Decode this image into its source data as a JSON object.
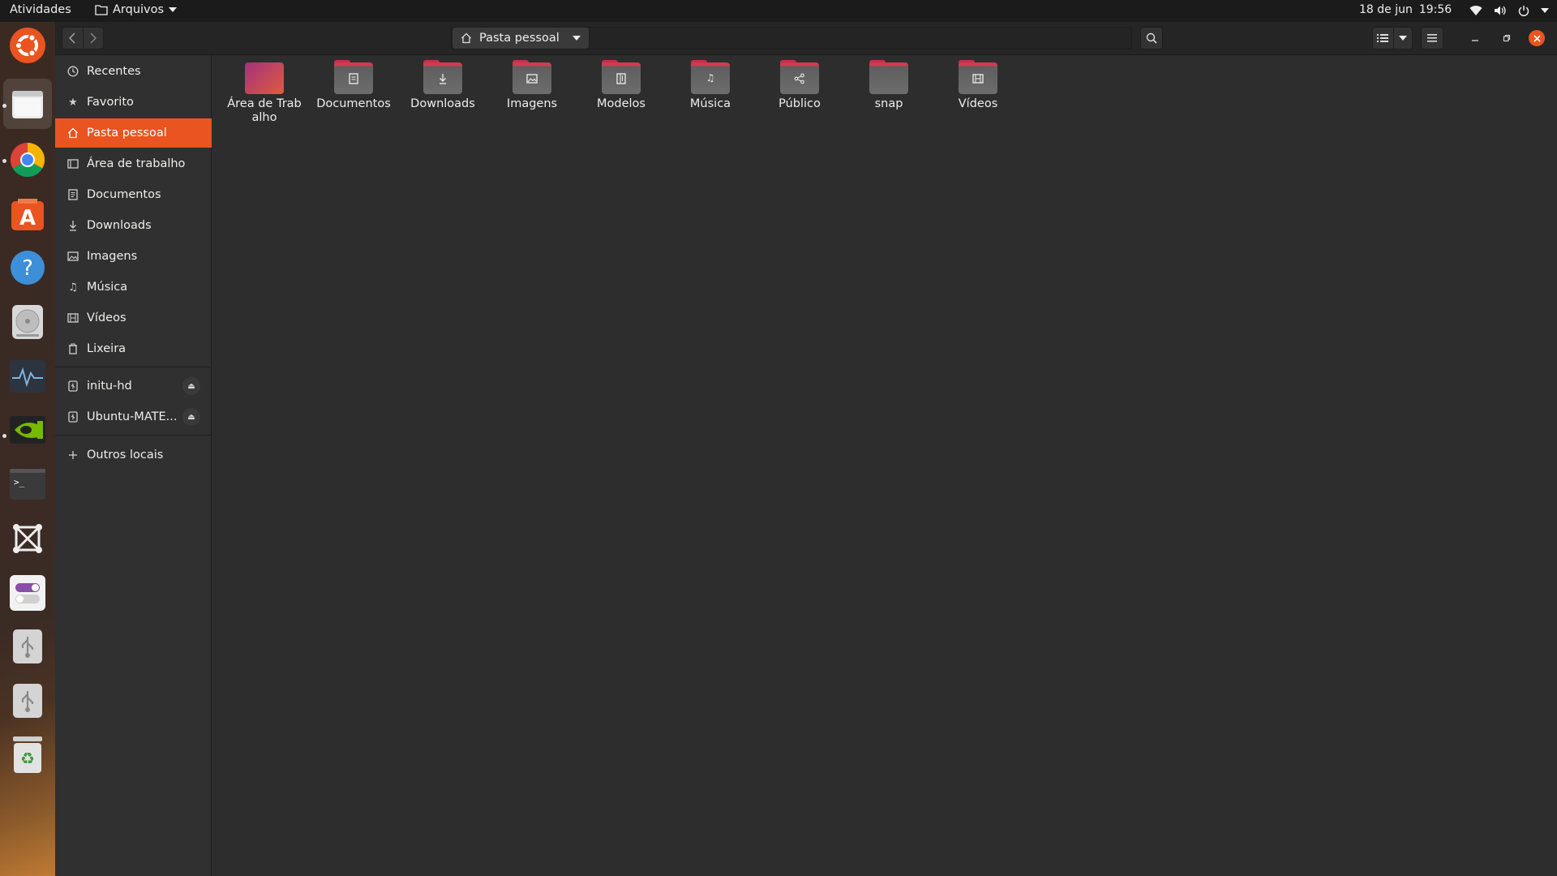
{
  "topbar": {
    "activities": "Atividades",
    "app_name": "Arquivos",
    "date": "18 de jun",
    "time": "19:56"
  },
  "dock": {
    "items": [
      {
        "name": "ubuntu-logo-icon"
      },
      {
        "name": "files-app-icon"
      },
      {
        "name": "chrome-icon"
      },
      {
        "name": "software-center-icon"
      },
      {
        "name": "help-icon"
      },
      {
        "name": "disks-icon"
      },
      {
        "name": "system-monitor-icon"
      },
      {
        "name": "nvidia-icon"
      },
      {
        "name": "terminal-icon"
      },
      {
        "name": "screenshot-tool-icon"
      },
      {
        "name": "settings-toggle-icon"
      },
      {
        "name": "usb-drive-icon"
      },
      {
        "name": "usb-drive-icon"
      },
      {
        "name": "trash-icon"
      }
    ]
  },
  "headerbar": {
    "location": "Pasta pessoal"
  },
  "sidebar": {
    "places": [
      {
        "label": "Recentes",
        "icon": "clock-icon"
      },
      {
        "label": "Favorito",
        "icon": "star-icon"
      },
      {
        "label": "Pasta pessoal",
        "icon": "home-icon",
        "selected": true
      },
      {
        "label": "Área de trabalho",
        "icon": "desktop-icon"
      },
      {
        "label": "Documentos",
        "icon": "document-icon"
      },
      {
        "label": "Downloads",
        "icon": "download-icon"
      },
      {
        "label": "Imagens",
        "icon": "image-icon"
      },
      {
        "label": "Música",
        "icon": "music-icon"
      },
      {
        "label": "Vídeos",
        "icon": "video-icon"
      },
      {
        "label": "Lixeira",
        "icon": "trash-icon"
      }
    ],
    "devices": [
      {
        "label": "initu-hd",
        "icon": "usb-drive-icon"
      },
      {
        "label": "Ubuntu-MATE...",
        "icon": "usb-drive-icon"
      }
    ],
    "other": {
      "label": "Outros locais",
      "icon": "plus-icon"
    }
  },
  "folders": [
    {
      "name": "Área de Trabalho",
      "icon": "desktop-folder-icon"
    },
    {
      "name": "Documentos",
      "icon": "documents-folder-icon"
    },
    {
      "name": "Downloads",
      "icon": "downloads-folder-icon"
    },
    {
      "name": "Imagens",
      "icon": "pictures-folder-icon"
    },
    {
      "name": "Modelos",
      "icon": "templates-folder-icon"
    },
    {
      "name": "Música",
      "icon": "music-folder-icon"
    },
    {
      "name": "Público",
      "icon": "public-folder-icon"
    },
    {
      "name": "snap",
      "icon": "folder-icon"
    },
    {
      "name": "Vídeos",
      "icon": "videos-folder-icon"
    }
  ],
  "colors": {
    "accent": "#e95420",
    "folder_tab": "#c1324b",
    "folder_body": "#666666",
    "close_button": "#e95420"
  }
}
